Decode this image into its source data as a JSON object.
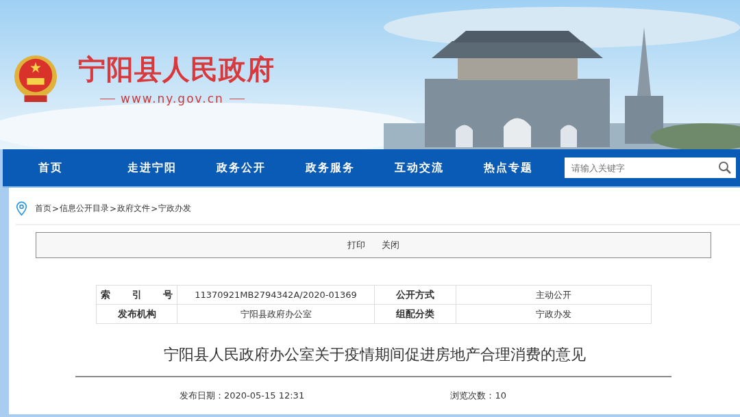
{
  "header": {
    "title": "宁阳县人民政府",
    "url": "www.ny.gov.cn"
  },
  "nav": {
    "items": [
      {
        "label": "首页",
        "selected": false
      },
      {
        "label": "走进宁阳",
        "selected": false
      },
      {
        "label": "政务公开",
        "selected": false
      },
      {
        "label": "政务服务",
        "selected": false
      },
      {
        "label": "互动交流",
        "selected": false
      },
      {
        "label": "热点专题",
        "selected": false
      }
    ],
    "search": {
      "placeholder": "请输入关键字"
    }
  },
  "breadcrumb": {
    "separator": ">",
    "items": [
      "首页",
      "信息公开目录",
      "政府文件",
      "宁政办发"
    ]
  },
  "toolbar": [
    "打印",
    "关闭"
  ],
  "info_table": [
    [
      "索引号",
      "11370921MB2794342A/2020-01369",
      "公开方式",
      "主动公开"
    ],
    [
      "发布机构",
      "宁阳县政府办公室",
      "组配分类",
      "宁政办发"
    ]
  ],
  "article": {
    "title": "宁阳县人民政府办公室关于疫情期间促进房地产合理消费的意见",
    "published": "发布日期：2020-05-15 12:31",
    "views": "浏览次数：10"
  }
}
